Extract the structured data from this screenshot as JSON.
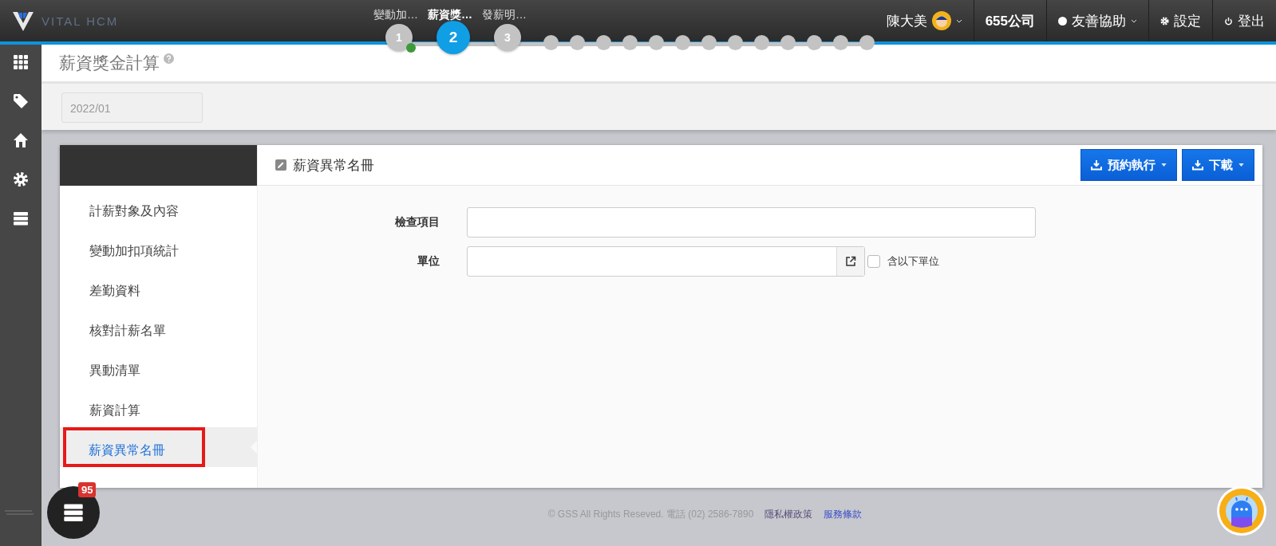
{
  "brand": {
    "name": "VITAL HCM"
  },
  "steps": [
    {
      "kind": "numbered",
      "number": "1",
      "label": "變動加…",
      "selected": false,
      "done": true
    },
    {
      "kind": "numbered",
      "number": "2",
      "label": "薪資獎…",
      "selected": true,
      "done": false
    },
    {
      "kind": "numbered",
      "number": "3",
      "label": "發薪明…",
      "selected": false,
      "done": false
    },
    {
      "kind": "dot"
    },
    {
      "kind": "dot"
    },
    {
      "kind": "dot"
    },
    {
      "kind": "dot"
    },
    {
      "kind": "dot"
    },
    {
      "kind": "dot"
    },
    {
      "kind": "dot"
    },
    {
      "kind": "dot"
    },
    {
      "kind": "dot"
    },
    {
      "kind": "dot"
    },
    {
      "kind": "dot"
    },
    {
      "kind": "dot"
    },
    {
      "kind": "dot"
    }
  ],
  "topbar": {
    "user": "陳大美",
    "company": "655公司",
    "help": "友善協助",
    "settings": "設定",
    "logout": "登出"
  },
  "sidebar_icons": [
    {
      "kind": "grid"
    },
    {
      "kind": "tag"
    },
    {
      "kind": "home"
    },
    {
      "kind": "gear"
    },
    {
      "kind": "stack"
    }
  ],
  "page_title": "薪資獎金計算",
  "period": {
    "value": "2022/01"
  },
  "nav": [
    {
      "label": "計薪對象及內容",
      "selected": false
    },
    {
      "label": "變動加扣項統計",
      "selected": false
    },
    {
      "label": "差勤資料",
      "selected": false
    },
    {
      "label": "核對計薪名單",
      "selected": false
    },
    {
      "label": "異動清單",
      "selected": false
    },
    {
      "label": "薪資計算",
      "selected": false
    },
    {
      "label": "薪資異常名冊",
      "selected": true
    }
  ],
  "panel": {
    "title": "薪資異常名冊",
    "buttons": [
      "預約執行",
      "下載"
    ]
  },
  "form": {
    "fields": [
      {
        "kind": "text",
        "label": "檢查項目"
      },
      {
        "kind": "picker",
        "label": "單位",
        "checkbox": {
          "label": "含以下單位",
          "checked": false
        }
      }
    ]
  },
  "notifications": {
    "count": "95"
  },
  "footer": {
    "copyright": "© GSS All Rights Reseved. 電話 (02) 2586-7890",
    "links": [
      "隱私權政策",
      "服務條款"
    ]
  }
}
